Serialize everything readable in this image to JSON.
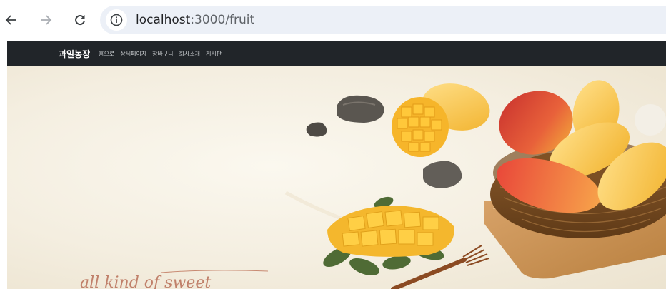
{
  "browser": {
    "url_host": "localhost",
    "url_path": ":3000/fruit",
    "back_icon": "arrow-left-icon",
    "forward_icon": "arrow-right-icon",
    "reload_icon": "reload-icon",
    "info_icon": "info-icon"
  },
  "navbar": {
    "brand": "과일농장",
    "links": [
      "홈으로",
      "상세페이지",
      "장바구니",
      "회사소개",
      "게시판"
    ],
    "background": "#212529"
  },
  "hero": {
    "tagline": "all kind of sweet"
  }
}
